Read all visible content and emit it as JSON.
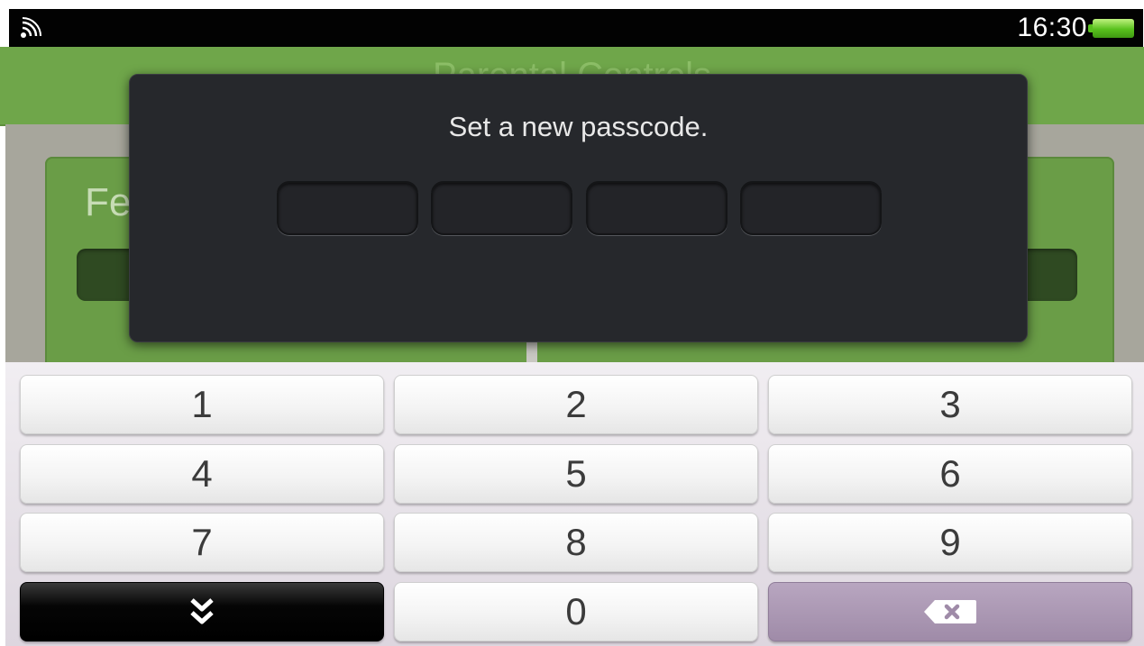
{
  "status_bar": {
    "time": "16:30",
    "wifi_icon": "wifi-signal-icon",
    "battery_icon": "battery-full-icon",
    "battery_color": "#58c11d"
  },
  "background_app": {
    "header_title": "Parental Controls",
    "panel_title": "Fe"
  },
  "dialog": {
    "message": "Set a new passcode.",
    "digit_slots": [
      "",
      "",
      "",
      ""
    ]
  },
  "keypad": {
    "keys": [
      "1",
      "2",
      "3",
      "4",
      "5",
      "6",
      "7",
      "8",
      "9",
      "0"
    ],
    "close_key_icon": "double-chevron-down-icon",
    "backspace_key_icon": "backspace-icon"
  },
  "colors": {
    "dialog_bg": "#26282c",
    "accent_green": "#6fa64a",
    "backspace_key": "#a995b2"
  }
}
